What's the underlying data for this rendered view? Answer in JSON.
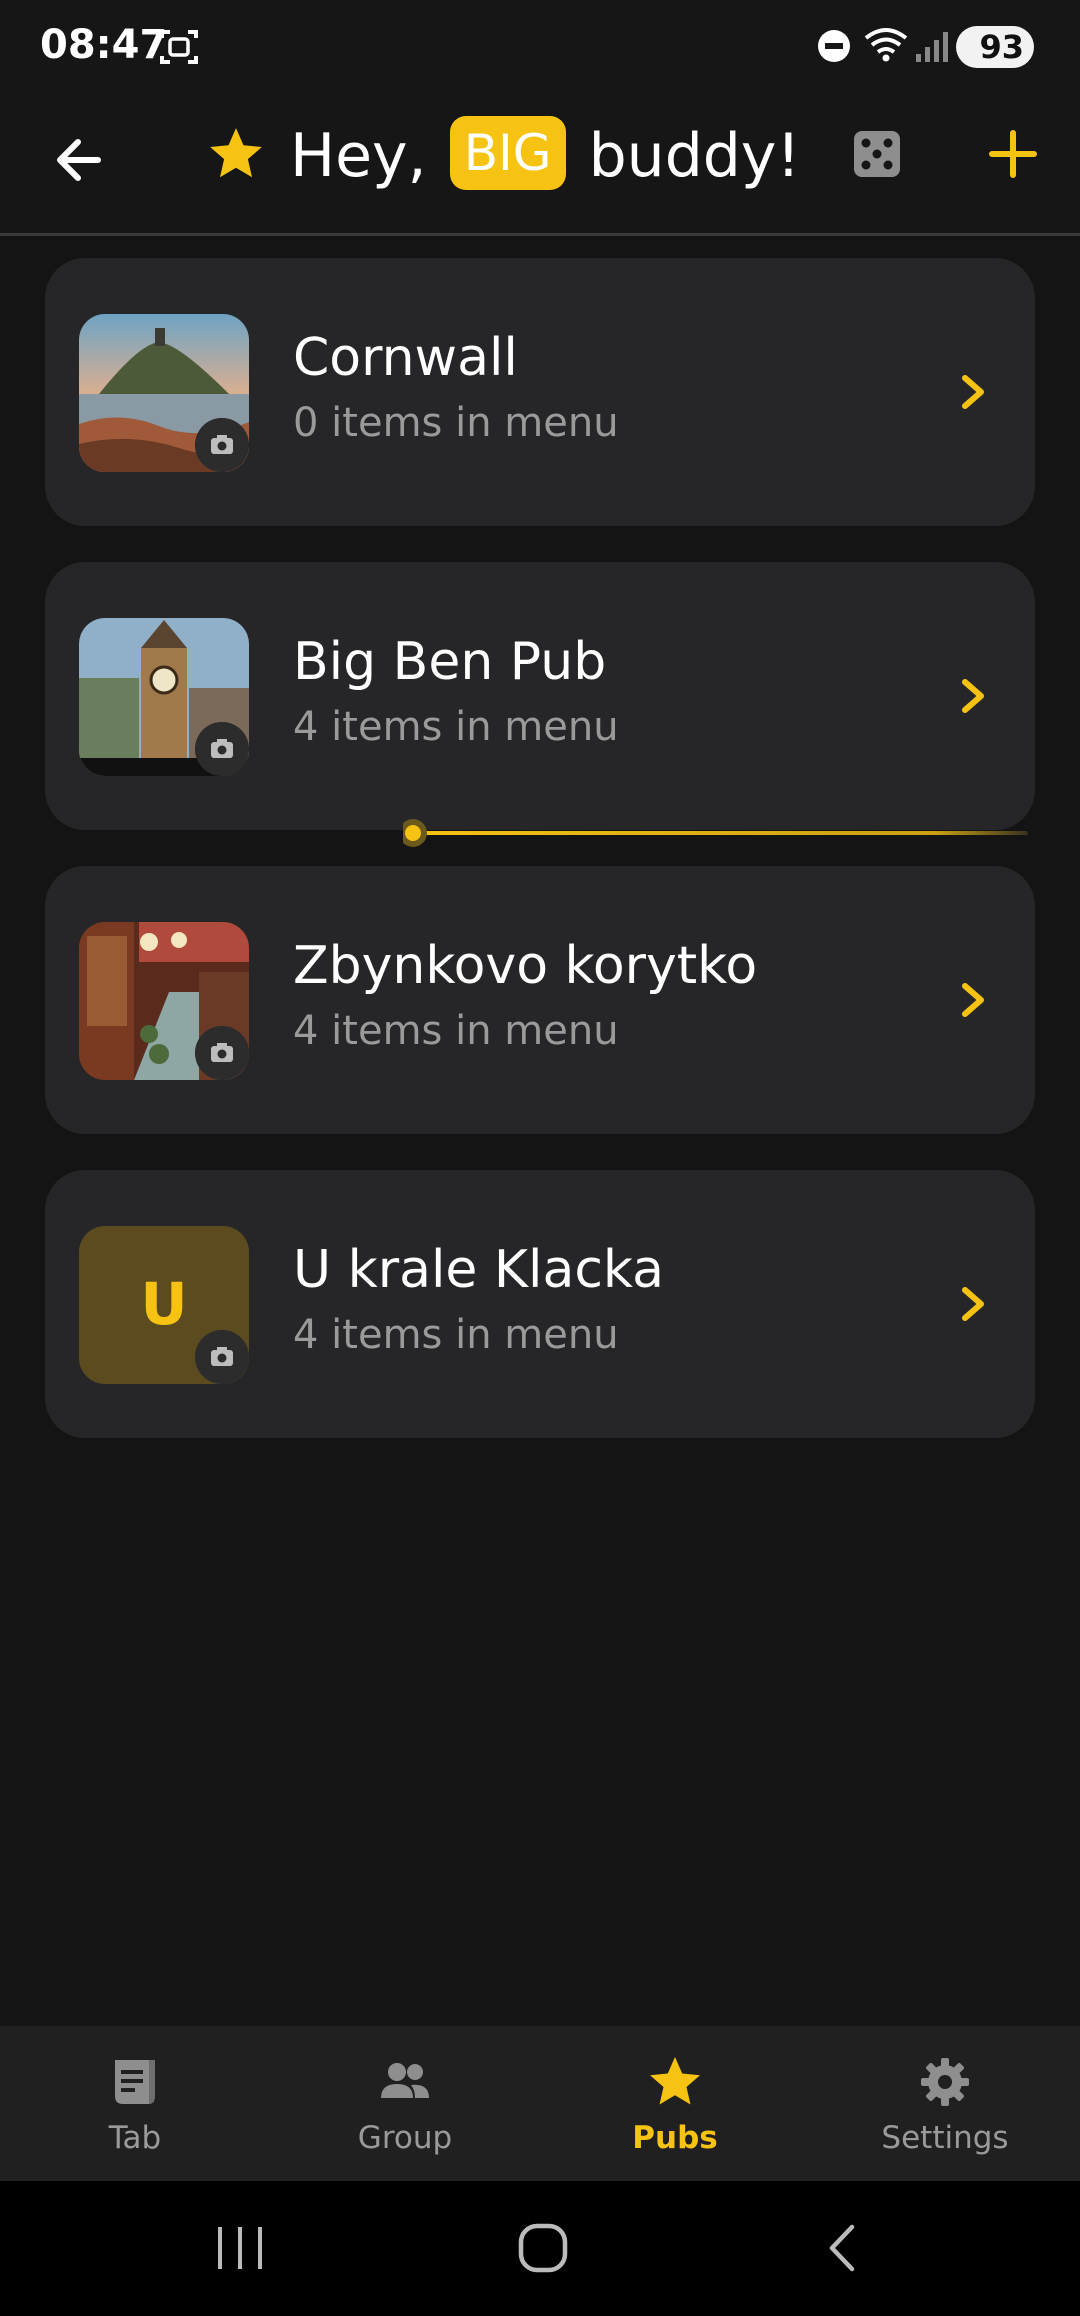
{
  "status_bar": {
    "time": "08:47",
    "battery": "93"
  },
  "header": {
    "title_prefix": "Hey,",
    "title_badge": "BIG",
    "title_suffix": "buddy!"
  },
  "pubs": [
    {
      "name": "Cornwall",
      "subtitle": "0 items in menu"
    },
    {
      "name": "Big Ben Pub",
      "subtitle": "4 items in menu"
    },
    {
      "name": "Zbynkovo korytko",
      "subtitle": "4 items in menu"
    },
    {
      "name": "U krale Klacka",
      "subtitle": "4 items in menu",
      "initial": "U"
    }
  ],
  "bottom_nav": [
    {
      "label": "Tab",
      "icon": "receipt-icon"
    },
    {
      "label": "Group",
      "icon": "group-icon"
    },
    {
      "label": "Pubs",
      "icon": "star-icon",
      "active": true
    },
    {
      "label": "Settings",
      "icon": "gear-icon"
    }
  ],
  "colors": {
    "accent": "#f6c313",
    "background": "#141414",
    "card": "#262629"
  }
}
